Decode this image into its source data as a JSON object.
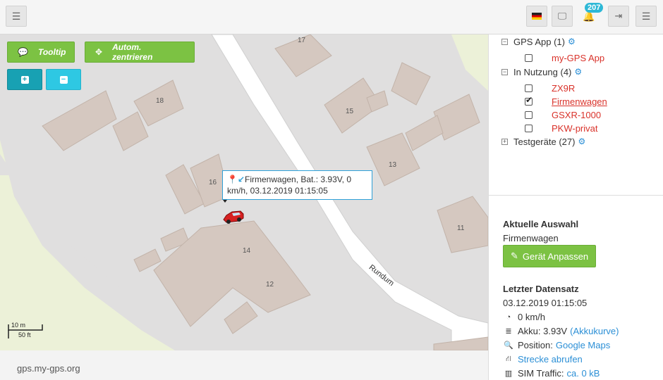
{
  "header": {
    "menu_icon": "hamburger-icon",
    "notification_count": "207",
    "colors": {
      "badge": "#2eb8d6"
    }
  },
  "map": {
    "buttons": {
      "tooltip": "Tooltip",
      "center": "Autom. zentrieren"
    },
    "house_numbers": [
      "17",
      "18",
      "15",
      "13",
      "16",
      "11",
      "14",
      "12"
    ],
    "street": "Rundum",
    "tooltip_text": "Firmenwagen, Bat.: 3.93V, 0 km/h, 03.12.2019 01:15:05",
    "scale": {
      "m": "10 m",
      "ft": "50 ft"
    }
  },
  "footer": {
    "text": "gps.my-gps.org"
  },
  "tree": {
    "groups": [
      {
        "label": "GPS App (1)",
        "expanded": true,
        "devices": [
          {
            "name": "my-GPS App",
            "checked": false
          }
        ]
      },
      {
        "label": "In Nutzung (4)",
        "expanded": true,
        "devices": [
          {
            "name": "ZX9R",
            "checked": false
          },
          {
            "name": "Firmenwagen",
            "checked": true
          },
          {
            "name": "GSXR-1000",
            "checked": false
          },
          {
            "name": "PKW-privat",
            "checked": false
          }
        ]
      },
      {
        "label": "Testgeräte (27)",
        "expanded": false,
        "devices": []
      }
    ]
  },
  "selection": {
    "heading": "Aktuelle Auswahl",
    "device": "Firmenwagen",
    "button": "Gerät Anpassen"
  },
  "last_record": {
    "heading": "Letzter Datensatz",
    "timestamp": "03.12.2019 01:15:05",
    "speed": "0 km/h",
    "battery_label": "Akku: 3.93V",
    "battery_link": "(Akkukurve)",
    "position_label": "Position:",
    "position_link": "Google Maps",
    "route_link": "Strecke abrufen",
    "sim_label": "SIM Traffic:",
    "sim_link": "ca. 0 kB"
  }
}
